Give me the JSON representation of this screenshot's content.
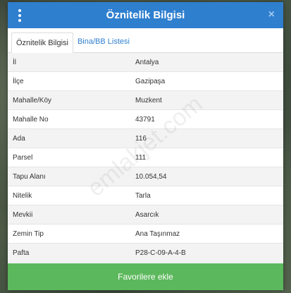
{
  "header": {
    "title": "Öznitelik Bilgisi",
    "close_glyph": "×",
    "menu_icon": "vertical-ellipsis-icon",
    "background_color": "#2f7fcf"
  },
  "tabs": [
    {
      "label": "Öznitelik Bilgisi",
      "active": true
    },
    {
      "label": "Bina/BB Listesi",
      "active": false
    }
  ],
  "attributes": [
    {
      "key": "İl",
      "value": "Antalya"
    },
    {
      "key": "İlçe",
      "value": "Gazipaşa"
    },
    {
      "key": "Mahalle/Köy",
      "value": "Muzkent"
    },
    {
      "key": "Mahalle No",
      "value": "43791"
    },
    {
      "key": "Ada",
      "value": "116"
    },
    {
      "key": "Parsel",
      "value": "111"
    },
    {
      "key": "Tapu Alanı",
      "value": "10.054,54"
    },
    {
      "key": "Nitelik",
      "value": "Tarla"
    },
    {
      "key": "Mevkii",
      "value": "Asarcık"
    },
    {
      "key": "Zemin Tip",
      "value": "Ana Taşınmaz"
    },
    {
      "key": "Pafta",
      "value": "P28-C-09-A-4-B"
    }
  ],
  "footer": {
    "favorite_label": "Favorilere ekle",
    "button_color": "#5cb85c"
  },
  "watermark": "emlakjet.com"
}
